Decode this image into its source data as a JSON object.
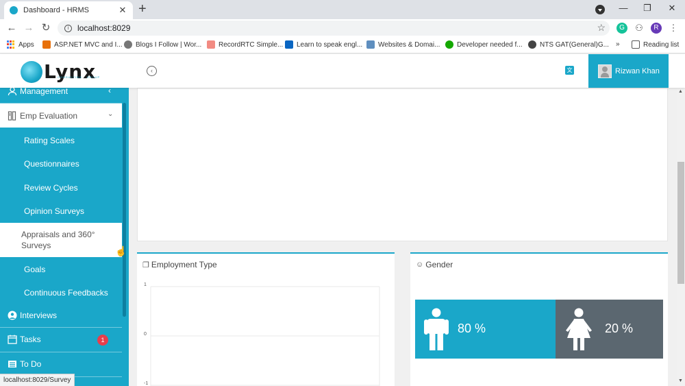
{
  "browser": {
    "tab_title": "Dashboard - HRMS",
    "tab_close": "✕",
    "new_tab": "+",
    "url": "localhost:8029",
    "status_url": "localhost:8029/Survey",
    "profile_initial": "R",
    "ext_g": "G",
    "bookmarks": [
      {
        "label": "Apps"
      },
      {
        "label": "ASP.NET MVC and I..."
      },
      {
        "label": "Blogs I Follow | Wor..."
      },
      {
        "label": "RecordRTC Simple..."
      },
      {
        "label": "Learn to speak engl..."
      },
      {
        "label": "Websites & Domai..."
      },
      {
        "label": "Developer needed f..."
      },
      {
        "label": "NTS GAT(General)G..."
      }
    ],
    "more_bookmarks": "»",
    "reading_list": "Reading list"
  },
  "header": {
    "logo_text": "Lynx",
    "logo_tagline": "CONSULTING · GROUP",
    "user_name": "Rizwan Khan"
  },
  "sidebar": {
    "management": "Management",
    "emp_evaluation": "Emp Evaluation",
    "sub_items": [
      {
        "label": "Rating Scales"
      },
      {
        "label": "Questionnaires"
      },
      {
        "label": "Review Cycles"
      },
      {
        "label": "Opinion Surveys"
      },
      {
        "label": "Appraisals and 360°\nSurveys"
      },
      {
        "label": "Goals"
      },
      {
        "label": "Continuous Feedbacks"
      }
    ],
    "interviews": "Interviews",
    "tasks": "Tasks",
    "tasks_badge": "1",
    "todo": "To Do"
  },
  "employment": {
    "title": "Employment Type",
    "ticks": [
      "1",
      "0",
      "-1"
    ]
  },
  "gender": {
    "title": "Gender",
    "male_pct": "80 %",
    "female_pct": "20 %"
  },
  "colors": {
    "accent": "#1aa7c9",
    "female_panel": "#5b6770",
    "badge": "#e83e4c"
  }
}
